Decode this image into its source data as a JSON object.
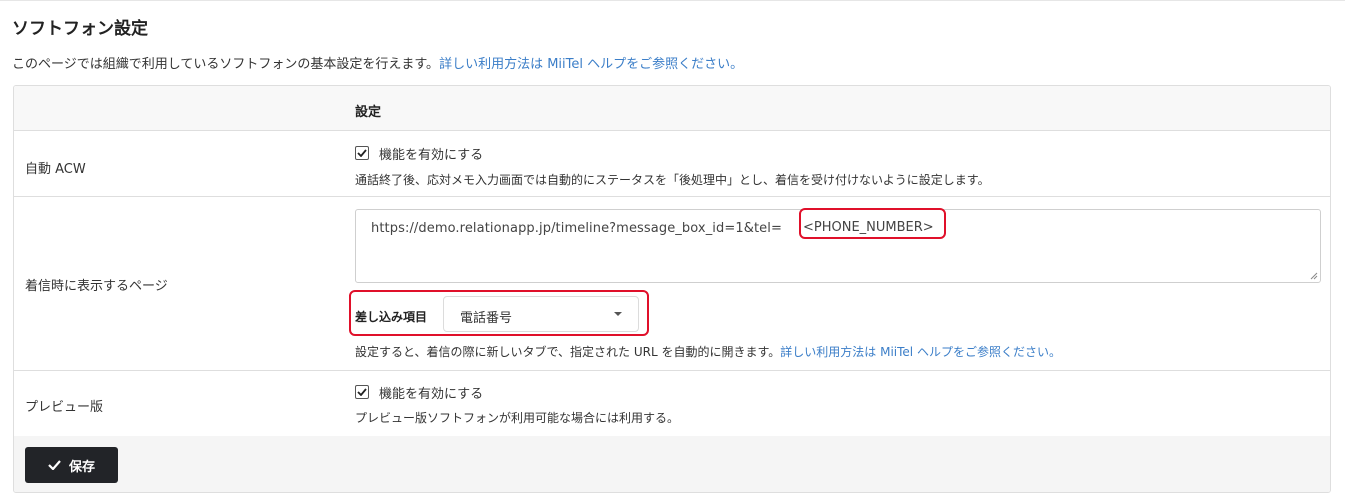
{
  "page": {
    "title": "ソフトフォン設定",
    "intro_text": "このページでは組織で利用しているソフトフォンの基本設定を行えます。",
    "intro_link": "詳しい利用方法は MiiTel ヘルプをご参照ください。"
  },
  "table": {
    "header_label": "設定",
    "rows": {
      "auto_acw": {
        "label": "自動 ACW",
        "checkbox_label": "機能を有効にする",
        "checked": true,
        "description": "通話終了後、応対メモ入力画面では自動的にステータスを「後処理中」とし、着信を受け付けないように設定します。"
      },
      "incoming_page": {
        "label": "着信時に表示するページ",
        "url_value": "https://demo.relationapp.jp/timeline?message_box_id=1&tel=",
        "url_placeholder_token": "<PHONE_NUMBER>",
        "insert_label": "差し込み項目",
        "insert_selected": "電話番号",
        "description": "設定すると、着信の際に新しいタブで、指定された URL を自動的に開きます。",
        "description_link": "詳しい利用方法は MiiTel ヘルプをご参照ください。"
      },
      "preview": {
        "label": "プレビュー版",
        "checkbox_label": "機能を有効にする",
        "checked": true,
        "description": "プレビュー版ソフトフォンが利用可能な場合には利用する。"
      }
    }
  },
  "footer": {
    "save_label": "保存"
  },
  "colors": {
    "link": "#3b7ec8",
    "highlight": "#e0102a",
    "button_bg": "#222428"
  },
  "icons": {
    "checkbox": "check-icon",
    "save": "check-icon",
    "select": "caret-down-icon",
    "resize": "resize-grip-icon"
  }
}
